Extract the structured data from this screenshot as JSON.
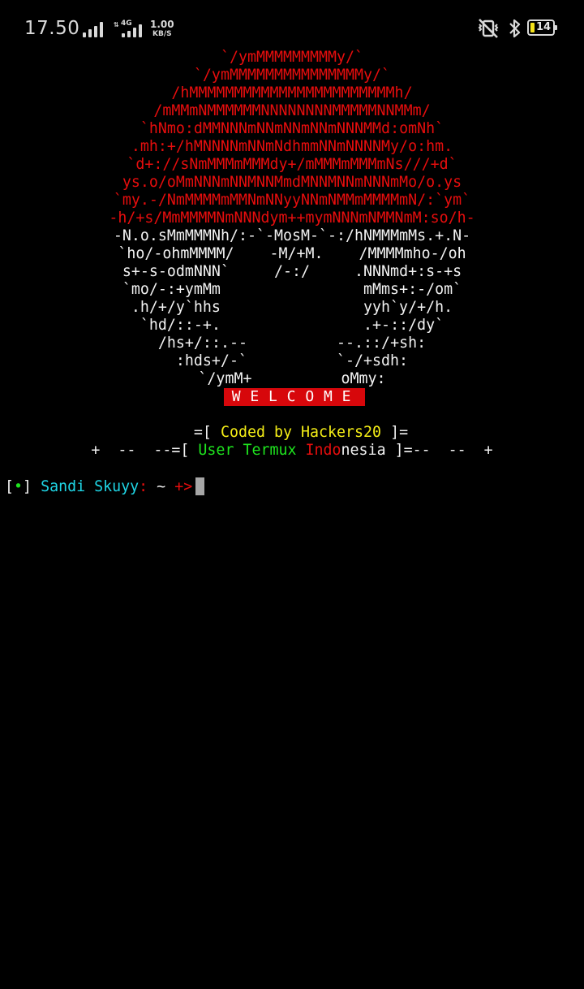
{
  "status_bar": {
    "time": "17.50",
    "network_type": "4G",
    "data_arrows": "⇅",
    "speed_value": "1.00",
    "speed_unit": "KB/S",
    "battery_level": "14",
    "icons": [
      "signal-icon",
      "signal-icon",
      "vibrate-mute-icon",
      "bluetooth-icon",
      "battery-icon"
    ],
    "colors": {
      "battery_fill": "#f4e11a",
      "text": "#d9d9d9"
    }
  },
  "banner": {
    "red_lines": [
      "`/ymMMMMMMMMMy/`",
      "`/ymMMMMMMMMMMMMMMMy/`",
      "/hMMMMMMMMMMMMMMMMMMMMMMMh/",
      "/mMMmNMMMMMMNNNNNNNNMMMMMNNMMm/",
      "`hNmo:dMMNNNmNNmNNmNNmNNNMMd:omNh`",
      ".mh:+/hMNNNNmNNmNdhmmNNmNNNNMy/o:hm.",
      "`d+://sNmMMMmMMMdy+/mMMMmMMMmNs///+d`",
      "ys.o/oMmNNNmNNMNNMmdMNNMNNmNNNmMo/o.ys",
      "`my.-/NmMMMMmMMNmNNyyNNmNMMmMMMMmN/:`ym`",
      "-h/+s/MmMMMMNmNNNdym++mymNNNmNMMNmM:so/h-"
    ],
    "white_lines": [
      "-N.o.sMmMMMNh/:-`-MosM-`-:/hNMMMmMs.+.N-",
      "`ho/-ohmMMMM/    -M/+M.    /MMMMmho-/oh",
      "s+-s-odmNNN`     /-:/     .NNNmd+:s-+s",
      "`mo/-:+ymMm                mMms+:-/om`",
      ".h/+/y`hhs                yyh`y/+/h.",
      "`hd/::-+.                .+-::/dy`",
      "/hs+/::.--          --.::/+sh:",
      ":hds+/-`          `-/+sdh:",
      "`/ymM+          oMmy:"
    ],
    "welcome": "WELCOME",
    "colors": {
      "art_red": "#e60d0d",
      "art_white": "#f2f2f2",
      "welcome_bg": "#d7070b"
    }
  },
  "credit": {
    "prefix": "=[ ",
    "coded_by": "Coded by Hackers20",
    "suffix": " ]="
  },
  "org": {
    "left": "+  --  --=[ ",
    "user_termux": "User Termux",
    "space": " ",
    "indo": "Indo",
    "nesia": "nesia",
    "right": " ]=--  --  +"
  },
  "prompt": {
    "open_bracket": "[",
    "dot": "•",
    "close_bracket": "]",
    "user": "Sandi Skuyy",
    "colon": ":",
    "tilde": "~",
    "arrow": "+>"
  }
}
